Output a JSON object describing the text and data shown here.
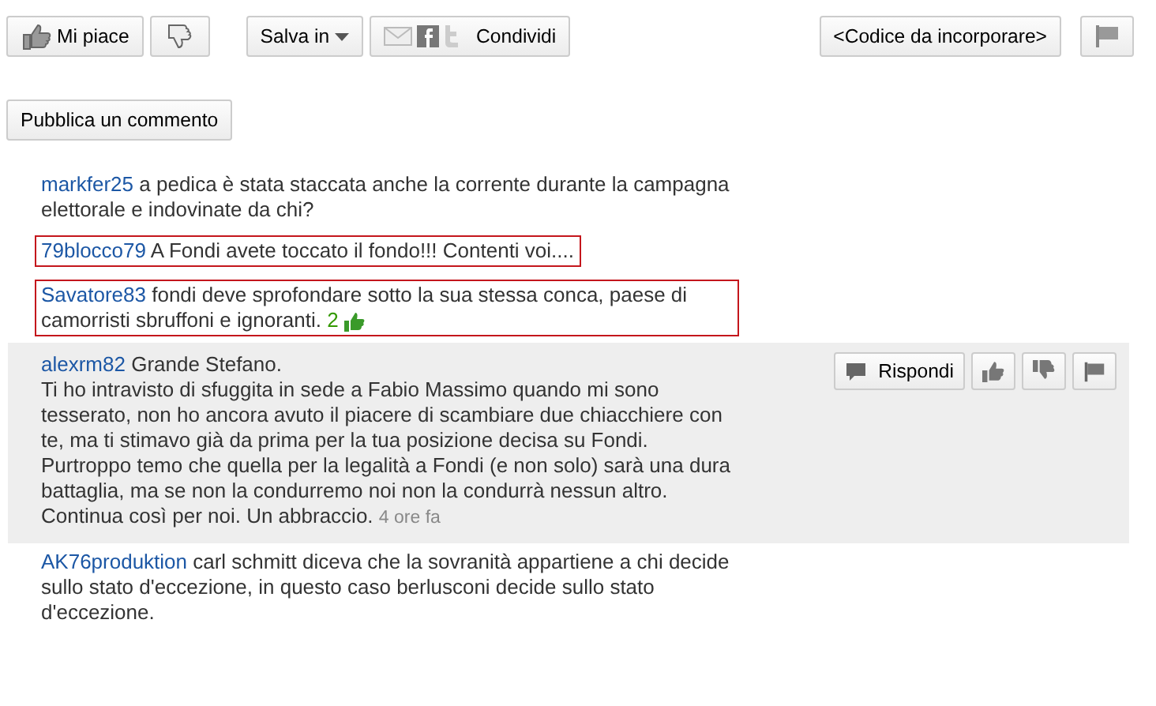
{
  "toolbar": {
    "like_button": "Mi piace",
    "save_button": "Salva in",
    "share_button": "Condividi",
    "embed_button": "<Codice da incorporare>"
  },
  "comment_button": "Pubblica un commento",
  "comments": [
    {
      "author": "markfer25",
      "text": "a pedica è stata staccata anche la corrente durante la campagna elettorale e indovinate da chi?",
      "highlighted": false,
      "hovered": false
    },
    {
      "author": "79blocco79",
      "text": "A Fondi avete toccato il fondo!!! Contenti voi....",
      "highlighted": true,
      "hovered": false
    },
    {
      "author": "Savatore83",
      "text": "fondi deve sprofondare sotto la sua stessa conca, paese di camorristi sbruffoni e ignoranti.",
      "likes": "2",
      "highlighted": true,
      "hovered": false
    },
    {
      "author": "alexrm82",
      "text": "Grande Stefano.\nTi ho intravisto di sfuggita in sede a Fabio Massimo quando mi sono tesserato, non ho ancora avuto il piacere di scambiare due chiacchiere con te, ma ti stimavo già da prima per la tua posizione decisa su Fondi. Purtroppo temo che quella per la legalità a Fondi (e non solo) sarà una dura battaglia, ma se non la condurremo noi non la condurrà nessun altro. Continua così per noi. Un abbraccio.",
      "time": "4 ore fa",
      "reply_button": "Rispondi",
      "highlighted": false,
      "hovered": true
    },
    {
      "author": "AK76produktion",
      "text": "carl schmitt diceva che la sovranità appartiene a chi decide sullo stato d'eccezione, in questo caso berlusconi decide sullo stato d'eccezione.",
      "highlighted": false,
      "hovered": false
    }
  ]
}
